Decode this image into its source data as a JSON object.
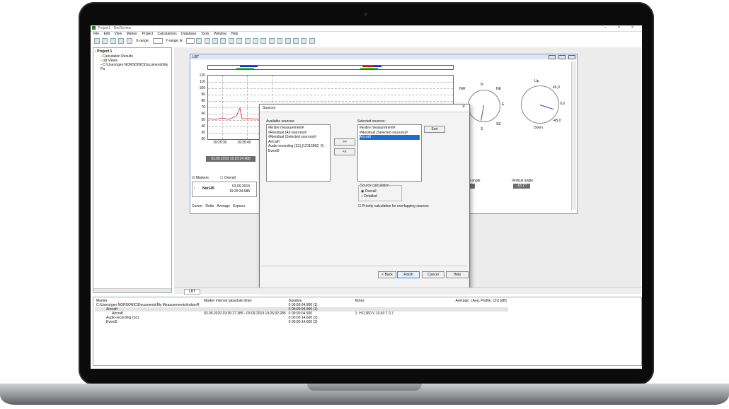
{
  "window": {
    "title": "Project1 - NorReview",
    "controls": [
      "–",
      "□",
      "×"
    ]
  },
  "menu": [
    "File",
    "Edit",
    "View",
    "Marker",
    "Project",
    "Calculations",
    "Database",
    "Tools",
    "Window",
    "Help"
  ],
  "toolbar": {
    "xrange_label": "X-range:",
    "yrange_label": "Y-range: A:"
  },
  "tree": {
    "root": "Project 1",
    "items": [
      "Calculation Results",
      "(d) Views",
      "C:\\Users\\gen NORSONIC\\Documents\\My Pa"
    ]
  },
  "doc": {
    "title": "LBT",
    "tab": "LBT",
    "y_ticks": [
      "120",
      "110",
      "100",
      "90",
      "80",
      "70",
      "60",
      "50",
      "40",
      "30",
      "20"
    ],
    "x_ticks": [
      "19:25:30",
      "19:25:40"
    ],
    "timestamp": "03.09.2019 19:25:34.685",
    "markers_label": "Markers",
    "overall_label": "Overall",
    "instrument": "Nor145",
    "inst_date": "03.09.2019",
    "inst_time": "19:25:34.685",
    "bottom_tabs": [
      "Cursor",
      "Delta",
      "Average",
      "Exposu"
    ],
    "compass": {
      "N": "N",
      "NE": "NE",
      "E": "E",
      "SE": "SE",
      "S": "S",
      "NW": "NW"
    },
    "angle_labels": {
      "horizontal": "al angle",
      "vertical": "Vertical angle"
    },
    "vertical_angle": "-18.2 °",
    "dial": {
      "up": "Up",
      "down": "Down",
      "t1": "45,0",
      "t2": "0,0",
      "t3": "-45,0"
    }
  },
  "dialog": {
    "title": "Sources",
    "available_label": "Available sources:",
    "available": [
      "#Entire measurement#",
      "#Residual (All sources)#",
      "#Residual (Selected sources)#",
      "Aircraft",
      "Audio-recording (S1),(12116992, 0)",
      "Event0"
    ],
    "selected_label": "Selected sources:",
    "selected": [
      "#Entire measurement#",
      "#Residual (Selected sources)#",
      "Aircraft"
    ],
    "add_btn": ">>",
    "remove_btn": "<<",
    "sort_btn": "Sort",
    "calc_label": "Source calculation",
    "opt_overall": "Overall",
    "opt_detailed": "Detailed",
    "priority_label": "Priority calculation for overlapping sources",
    "back_btn": "< Back",
    "finish_btn": "Finish",
    "cancel_btn": "Cancel",
    "help_btn": "Help"
  },
  "table": {
    "headers": [
      "Marker",
      "Marker interval (absolute time)",
      "Duration",
      "Notes",
      "Average: LAeq, Profile, Ch1 [dB]"
    ],
    "rows": [
      {
        "marker": "C:\\Users\\gen NORSONIC\\Documents\\My Measurements\\indoorR",
        "interval": "",
        "duration": "0 00:00:04.900 (1)",
        "notes": "",
        "avg": ""
      },
      {
        "marker": "Aircraft",
        "interval": "",
        "duration": "0 00:00:04.900 (1)",
        "notes": "",
        "avg": ""
      },
      {
        "marker": "Aircraft",
        "interval": "03.09.2019 19:26:27.385 - 03.09.2019 19:26:32.285",
        "duration": "0 00:00:04.900",
        "notes": "1: H 0,360 V 10,50 T 0,7",
        "avg": ""
      },
      {
        "marker": "Audio-recording (S1)",
        "interval": "",
        "duration": "0 00:00:14.600 (2)",
        "notes": "",
        "avg": ""
      },
      {
        "marker": "Event0",
        "interval": "",
        "duration": "0 00:00:14.600 (2)",
        "notes": "",
        "avg": ""
      }
    ]
  }
}
